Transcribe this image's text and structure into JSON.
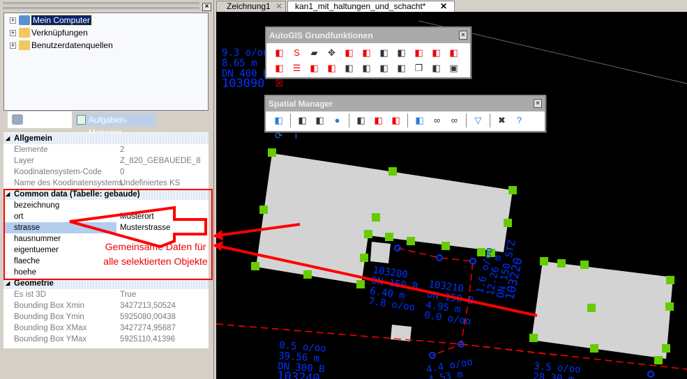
{
  "left_panel": {
    "tree": [
      {
        "label": "Mein Computer",
        "selected": true
      },
      {
        "label": "Verknüpfungen"
      },
      {
        "label": "Benutzerdatenquellen"
      }
    ],
    "tabs": [
      {
        "label": "",
        "icon": "database-icon"
      },
      {
        "label": "Aufgaben-Manager",
        "icon": "task-list-icon"
      }
    ],
    "properties": {
      "allgemein": {
        "title": "Allgemein",
        "rows": [
          [
            "Elemente",
            "2"
          ],
          [
            "Layer",
            "Z_820_GEBAUEDE_8"
          ],
          [
            "Koodinatensystem-Code",
            "0"
          ],
          [
            "Name des Koodinatensystems",
            "Undefiniertes KS"
          ]
        ]
      },
      "common": {
        "title": "Common data (Tabelle: gebaude)",
        "rows": [
          [
            "bezeichnung",
            ""
          ],
          [
            "ort",
            "Musterort"
          ],
          [
            "strasse",
            "Musterstrasse"
          ],
          [
            "hausnummer",
            ""
          ],
          [
            "eigentuemer",
            ""
          ],
          [
            "flaeche",
            ""
          ],
          [
            "hoehe",
            ""
          ]
        ],
        "selected": "strasse"
      },
      "geometrie": {
        "title": "Geometrie",
        "rows": [
          [
            "Es ist 3D",
            "True"
          ],
          [
            "Bounding Box Xmin",
            "3427213,50524"
          ],
          [
            "Bounding Box Ymin",
            "5925080,00438"
          ],
          [
            "Bounding Box XMax",
            "3427274,95687"
          ],
          [
            "Bounding Box YMax",
            "5925110,41396"
          ]
        ]
      }
    }
  },
  "annotation": {
    "line1": "Gemeinsame Daten für",
    "line2": "alle selektierten Objekte",
    "color": "#ff0000"
  },
  "doc_tabs": [
    {
      "label": "Zeichnung1",
      "active": false
    },
    {
      "label": "kan1_mit_haltungen_und_schacht*",
      "active": true
    }
  ],
  "toolbars": {
    "autogis": {
      "title": "AutoGIS Grundfunktionen",
      "icons": [
        "polygon-select-icon",
        "sql-icon",
        "open-folder-icon",
        "move-icon",
        "insert-icon",
        "split-icon",
        "break-icon",
        "flip-icon",
        "attribute-down-icon",
        "attribute-copy-icon",
        "edit-line-icon",
        "edit-line-red-icon",
        "document-icon",
        "key-document-icon",
        "key-edit-icon",
        "key-copy-icon",
        "key-pen-icon",
        "key-search-icon",
        "lamp-icon",
        "copy-icon",
        "paint-icon",
        "save-icon",
        "delete-save-icon"
      ]
    },
    "spatial": {
      "title": "Spatial Manager",
      "icons": [
        "panel-icon",
        "|",
        "import-icon",
        "export-icon",
        "globe-icon",
        "|",
        "image-icon",
        "image-delete-icon",
        "image-edit-icon",
        "|",
        "table-edit-icon",
        "link-icon",
        "unlink-icon",
        "|",
        "filter-icon",
        "|",
        "tools-icon",
        "help-icon",
        "refresh-icon",
        "info-icon"
      ]
    }
  },
  "drawing": {
    "labels": [
      {
        "lines": [
          "9.3 o/oo",
          "8.65 m",
          "DN 400 B",
          "103090"
        ]
      },
      {
        "lines": [
          "103200",
          "DN 150 B",
          "6.40 m",
          "7.8 o/oo"
        ]
      },
      {
        "lines": [
          "103210",
          "DN 150 B",
          "4.95 m",
          "0.0 o/oo"
        ]
      },
      {
        "lines": [
          "1.6 o/oo",
          "12.26 m",
          "DN 150 STZ",
          "103220"
        ]
      },
      {
        "lines": [
          "0.5 o/oo",
          "39.56 m",
          "DN 300 B",
          "103240"
        ]
      },
      {
        "lines": [
          "4.4 o/oo",
          "4.53 m"
        ]
      },
      {
        "lines": [
          "3.5 o/oo",
          "28.30 m"
        ]
      }
    ],
    "colors": {
      "building": "#d3d3d3",
      "grip": "#66cc00",
      "pipe": "#ff0000",
      "text": "#0033ff"
    }
  }
}
